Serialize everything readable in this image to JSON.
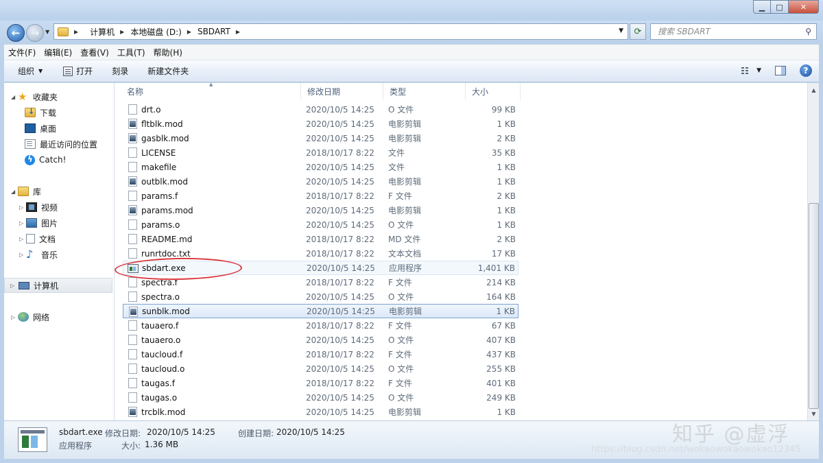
{
  "window": {
    "min_label": "▁",
    "max_label": "□",
    "close_label": "✕"
  },
  "nav": {
    "back_label": "←",
    "forward_label": "→",
    "breadcrumb": [
      "计算机",
      "本地磁盘 (D:)",
      "SBDART"
    ],
    "search_placeholder": "搜索 SBDART"
  },
  "menu": [
    "文件(F)",
    "编辑(E)",
    "查看(V)",
    "工具(T)",
    "帮助(H)"
  ],
  "toolbar": {
    "organize": "组织",
    "open": "打开",
    "burn": "刻录",
    "new_folder": "新建文件夹"
  },
  "sidebar": {
    "favorites": "收藏夹",
    "downloads": "下载",
    "desktop": "桌面",
    "recent": "最近访问的位置",
    "catch": "Catch!",
    "libraries": "库",
    "videos": "视频",
    "pictures": "图片",
    "documents": "文档",
    "music": "音乐",
    "computer": "计算机",
    "network": "网络"
  },
  "columns": {
    "name": "名称",
    "date": "修改日期",
    "type": "类型",
    "size": "大小"
  },
  "files": [
    {
      "name": "drt.o",
      "date": "2020/10/5 14:25",
      "type": "O 文件",
      "size": "99 KB",
      "icon": "blank"
    },
    {
      "name": "fltblk.mod",
      "date": "2020/10/5 14:25",
      "type": "电影剪辑",
      "size": "1 KB",
      "icon": "mod"
    },
    {
      "name": "gasblk.mod",
      "date": "2020/10/5 14:25",
      "type": "电影剪辑",
      "size": "2 KB",
      "icon": "mod"
    },
    {
      "name": "LICENSE",
      "date": "2018/10/17 8:22",
      "type": "文件",
      "size": "35 KB",
      "icon": "blank"
    },
    {
      "name": "makefile",
      "date": "2020/10/5 14:25",
      "type": "文件",
      "size": "1 KB",
      "icon": "blank"
    },
    {
      "name": "outblk.mod",
      "date": "2020/10/5 14:25",
      "type": "电影剪辑",
      "size": "1 KB",
      "icon": "mod"
    },
    {
      "name": "params.f",
      "date": "2018/10/17 8:22",
      "type": "F 文件",
      "size": "2 KB",
      "icon": "blank"
    },
    {
      "name": "params.mod",
      "date": "2020/10/5 14:25",
      "type": "电影剪辑",
      "size": "1 KB",
      "icon": "mod"
    },
    {
      "name": "params.o",
      "date": "2020/10/5 14:25",
      "type": "O 文件",
      "size": "1 KB",
      "icon": "blank"
    },
    {
      "name": "README.md",
      "date": "2018/10/17 8:22",
      "type": "MD 文件",
      "size": "2 KB",
      "icon": "blank"
    },
    {
      "name": "runrtdoc.txt",
      "date": "2018/10/17 8:22",
      "type": "文本文档",
      "size": "17 KB",
      "icon": "blank"
    },
    {
      "name": "sbdart.exe",
      "date": "2020/10/5 14:25",
      "type": "应用程序",
      "size": "1,401 KB",
      "icon": "exe"
    },
    {
      "name": "spectra.f",
      "date": "2018/10/17 8:22",
      "type": "F 文件",
      "size": "214 KB",
      "icon": "blank"
    },
    {
      "name": "spectra.o",
      "date": "2020/10/5 14:25",
      "type": "O 文件",
      "size": "164 KB",
      "icon": "blank"
    },
    {
      "name": "sunblk.mod",
      "date": "2020/10/5 14:25",
      "type": "电影剪辑",
      "size": "1 KB",
      "icon": "mod"
    },
    {
      "name": "tauaero.f",
      "date": "2018/10/17 8:22",
      "type": "F 文件",
      "size": "67 KB",
      "icon": "blank"
    },
    {
      "name": "tauaero.o",
      "date": "2020/10/5 14:25",
      "type": "O 文件",
      "size": "407 KB",
      "icon": "blank"
    },
    {
      "name": "taucloud.f",
      "date": "2018/10/17 8:22",
      "type": "F 文件",
      "size": "437 KB",
      "icon": "blank"
    },
    {
      "name": "taucloud.o",
      "date": "2020/10/5 14:25",
      "type": "O 文件",
      "size": "255 KB",
      "icon": "blank"
    },
    {
      "name": "taugas.f",
      "date": "2018/10/17 8:22",
      "type": "F 文件",
      "size": "401 KB",
      "icon": "blank"
    },
    {
      "name": "taugas.o",
      "date": "2020/10/5 14:25",
      "type": "O 文件",
      "size": "249 KB",
      "icon": "blank"
    },
    {
      "name": "trcblk.mod",
      "date": "2020/10/5 14:25",
      "type": "电影剪辑",
      "size": "1 KB",
      "icon": "mod"
    }
  ],
  "details": {
    "filename": "sbdart.exe",
    "type": "应用程序",
    "modified_label": "修改日期:",
    "modified_value": "2020/10/5 14:25",
    "created_label": "创建日期:",
    "created_value": "2020/10/5 14:25",
    "size_label": "大小:",
    "size_value": "1.36 MB"
  },
  "watermark": {
    "text": "知乎 @虚浮",
    "url": "https://blog.csdn.net/wokaowokaowokao12345"
  }
}
